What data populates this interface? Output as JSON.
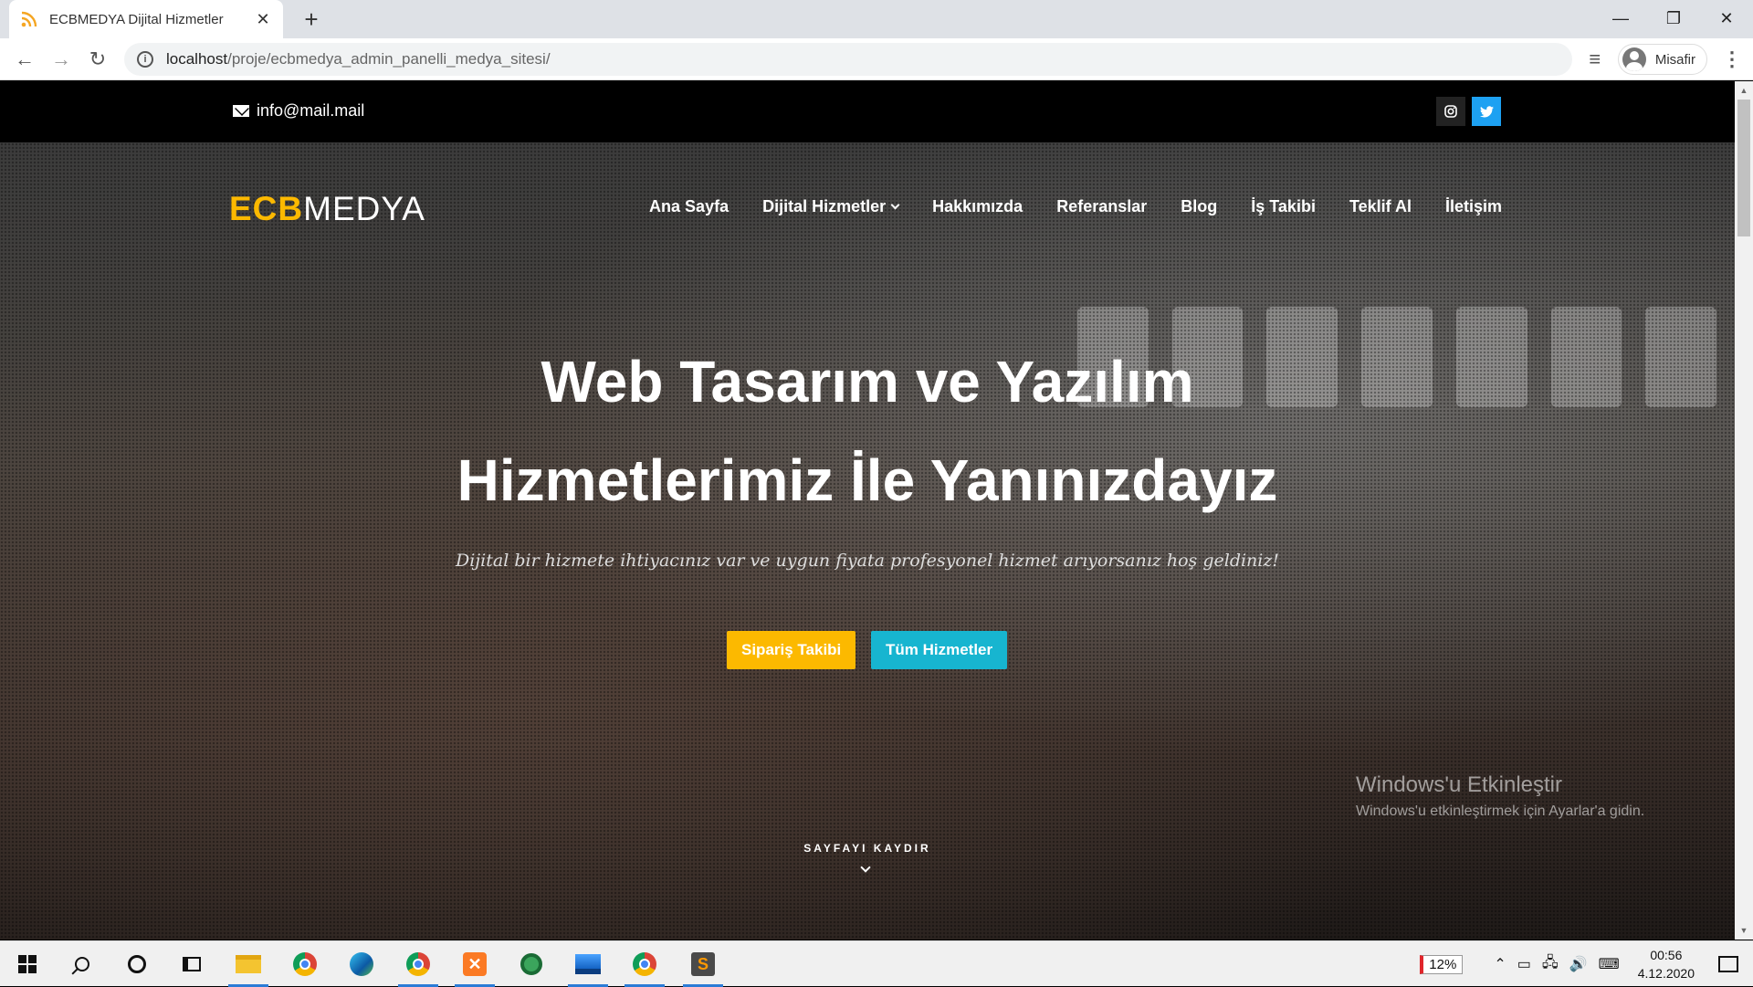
{
  "browser": {
    "tab_title": "ECBMEDYA Dijital Hizmetler",
    "url_host": "localhost",
    "url_path": "/proje/ecbmedya_admin_panelli_medya_sitesi/",
    "profile_name": "Misafir"
  },
  "topbar": {
    "email": "info@mail.mail"
  },
  "site": {
    "logo_part1": "ECB",
    "logo_part2": "MEDYA",
    "nav": [
      "Ana Sayfa",
      "Dijital Hizmetler",
      "Hakkımızda",
      "Referanslar",
      "Blog",
      "İş Takibi",
      "Teklif Al",
      "İletişim"
    ]
  },
  "hero": {
    "headline_line1": "Web Tasarım ve Yazılım",
    "headline_line2": "Hizmetlerimiz İle Yanınızdayız",
    "subtitle": "Dijital bir hizmete ihtiyacınız var ve uygun fiyata profesyonel hizmet arıyorsanız hoş geldiniz!",
    "btn_primary": "Sipariş Takibi",
    "btn_secondary": "Tüm Hizmetler",
    "scroll_label": "SAYFAYI KAYDIR"
  },
  "watermark": {
    "title": "Windows'u Etkinleştir",
    "subtitle": "Windows'u etkinleştirmek için Ayarlar'a gidin."
  },
  "taskbar": {
    "battery": "12%",
    "time": "00:56",
    "date": "4.12.2020"
  },
  "colors": {
    "brand_yellow": "#fcb900",
    "brand_cyan": "#17b5d0",
    "twitter_blue": "#1da1f2"
  }
}
